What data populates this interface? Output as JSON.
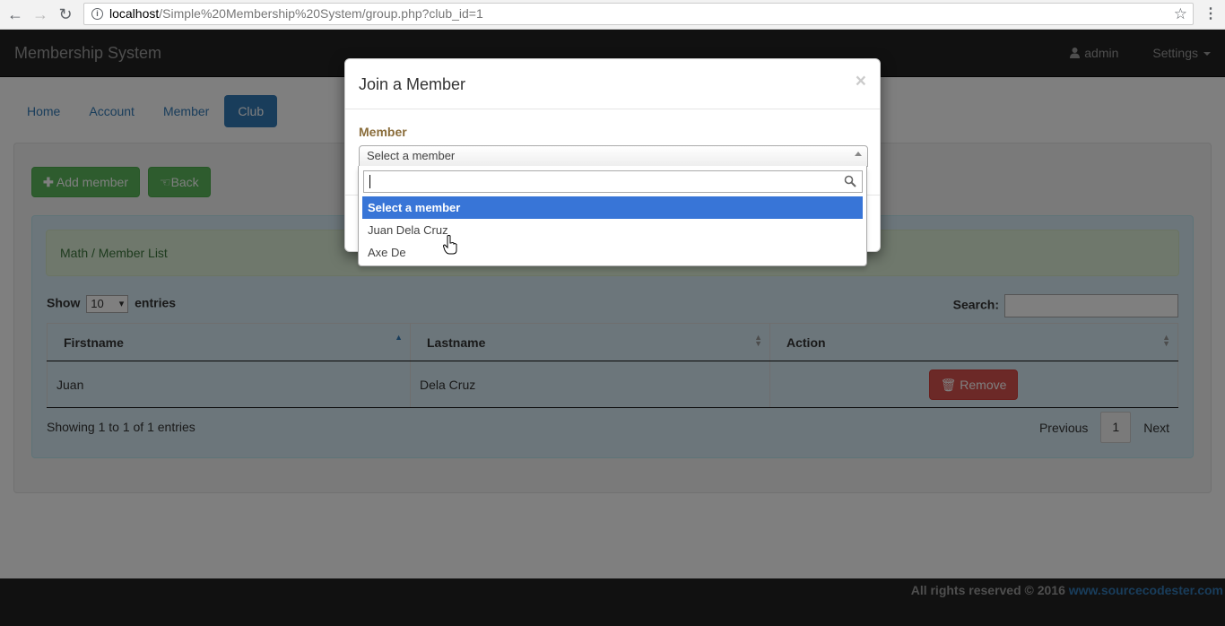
{
  "browser": {
    "url_host": "localhost",
    "url_path": "/Simple%20Membership%20System/group.php?club_id=1"
  },
  "navbar": {
    "brand": "Membership System",
    "user": "admin",
    "settings": "Settings"
  },
  "nav_pills": [
    {
      "label": "Home",
      "active": false
    },
    {
      "label": "Account",
      "active": false
    },
    {
      "label": "Member",
      "active": false
    },
    {
      "label": "Club",
      "active": true
    }
  ],
  "buttons": {
    "add_member": "Add member",
    "back": "Back",
    "remove": "Remove"
  },
  "alert": {
    "text": "Math / Member List"
  },
  "table_controls": {
    "show_label": "Show",
    "entries_label": "entries",
    "page_length": "10",
    "search_label": "Search:"
  },
  "table": {
    "headers": [
      "Firstname",
      "Lastname",
      "Action"
    ],
    "rows": [
      {
        "firstname": "Juan",
        "lastname": "Dela Cruz"
      }
    ],
    "info": "Showing 1 to 1 of 1 entries",
    "pagination": {
      "previous": "Previous",
      "current": "1",
      "next": "Next"
    }
  },
  "footer": {
    "text": "All rights reserved © 2016 ",
    "link": "www.sourcecodester.com"
  },
  "modal": {
    "title": "Join a Member",
    "close": "×",
    "field_label": "Member",
    "select_value": "Select a member",
    "options": [
      "Select a member",
      "Juan Dela Cruz",
      "Axe De"
    ],
    "highlighted_option": "Select a member"
  },
  "colors": {
    "primary": "#337ab7",
    "success": "#5cb85c",
    "danger": "#d9534f",
    "navbar": "#222222",
    "highlight": "#3875d7"
  }
}
